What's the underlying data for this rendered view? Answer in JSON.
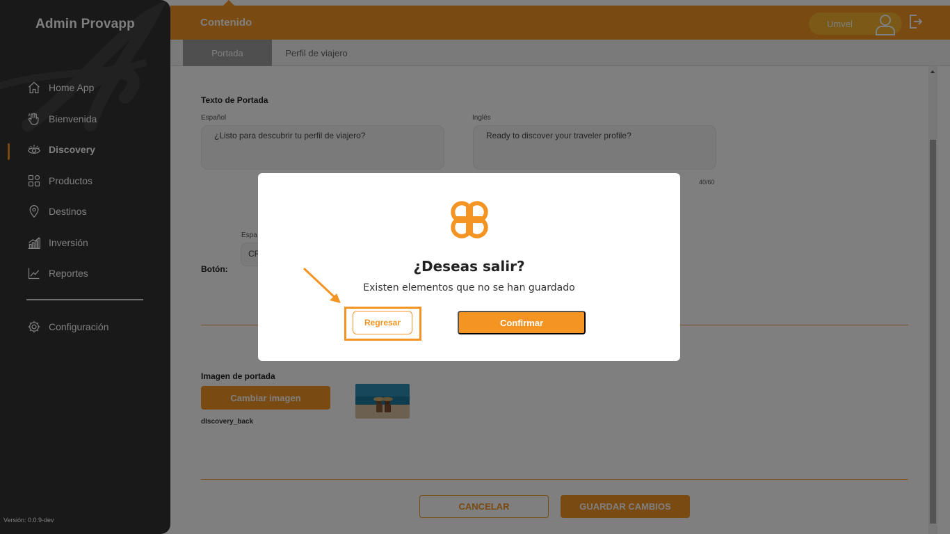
{
  "sidebar": {
    "brand": "Admin Provapp",
    "items": [
      {
        "label": "Home App",
        "icon": "home-icon"
      },
      {
        "label": "Bienvenida",
        "icon": "wave-hand-icon"
      },
      {
        "label": "Discovery",
        "icon": "eye-icon",
        "active": true
      },
      {
        "label": "Productos",
        "icon": "grid-icon"
      },
      {
        "label": "Destinos",
        "icon": "location-pin-icon"
      },
      {
        "label": "Inversión",
        "icon": "bar-chart-icon"
      },
      {
        "label": "Reportes",
        "icon": "line-chart-icon"
      }
    ],
    "settings": {
      "label": "Configuración",
      "icon": "gear-icon"
    },
    "version": "Versión: 0.0.9-dev"
  },
  "topbar": {
    "title": "Contenido",
    "user_name": "Umvel"
  },
  "tabs": [
    {
      "label": "Portada",
      "active": true
    },
    {
      "label": "Perfil de viajero",
      "active": false
    }
  ],
  "form": {
    "cover_text_title": "Texto de Portada",
    "spanish_label": "Español",
    "english_label": "Inglés",
    "spanish_value": "¿Listo para descubrir tu perfil de viajero?",
    "english_value": "Ready to discover your traveler profile?",
    "counter": "40/60",
    "button_section_label": "Botón:",
    "button_field_label_partial": "Espa",
    "button_field_value_partial": "CR",
    "cover_image_title": "Imagen de portada",
    "change_image_label": "Cambiar imagen",
    "file_name": "dIscovery_back",
    "cancel_label": "CANCELAR",
    "save_label": "GUARDAR CAMBIOS"
  },
  "dialog": {
    "title": "¿Deseas salir?",
    "message": "Existen elementos que no se han guardado",
    "back_label": "Regresar",
    "confirm_label": "Confirmar"
  },
  "colors": {
    "accent": "#f39423",
    "sidebar_bg": "#333333",
    "user_pill": "#f6b22e"
  }
}
